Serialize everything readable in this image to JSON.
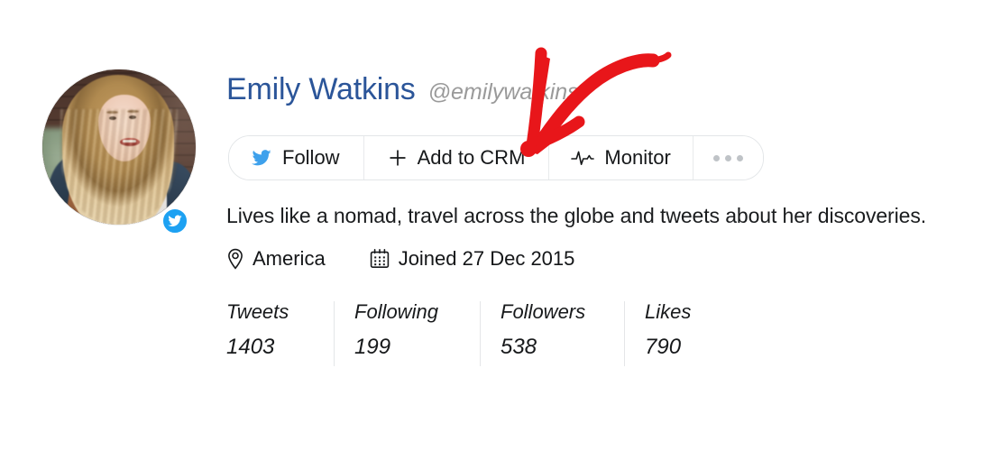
{
  "profile": {
    "display_name": "Emily Watkins",
    "handle": "@emilywatkins",
    "bio": "Lives like a nomad, travel across the globe and tweets about her discoveries.",
    "avatar_alt": "Emily Watkins profile photo",
    "network_badge": "twitter-badge",
    "name_color": "#2b5599",
    "handle_color": "#9a9a9a"
  },
  "actions": {
    "follow": {
      "label": "Follow",
      "icon": "twitter-bird-icon"
    },
    "add_to_crm": {
      "label": "Add to CRM",
      "icon": "plus-icon"
    },
    "monitor": {
      "label": "Monitor",
      "icon": "pulse-icon"
    },
    "more": {
      "label": "",
      "icon": "ellipsis-icon"
    }
  },
  "meta": {
    "location": {
      "text": "America",
      "icon": "location-pin-icon"
    },
    "joined": {
      "text": "Joined 27 Dec 2015",
      "icon": "calendar-icon"
    }
  },
  "stats": [
    {
      "key": "Tweets",
      "value": "1403"
    },
    {
      "key": "Following",
      "value": "199"
    },
    {
      "key": "Followers",
      "value": "538"
    },
    {
      "key": "Likes",
      "value": "790"
    }
  ],
  "annotation": {
    "type": "curved-arrow",
    "color": "#e8161a",
    "points_to": "Add to CRM"
  },
  "colors": {
    "twitter_blue": "#1da1f2",
    "annotation_red": "#e8161a",
    "border": "#e3e6e8",
    "text": "#16181a"
  }
}
